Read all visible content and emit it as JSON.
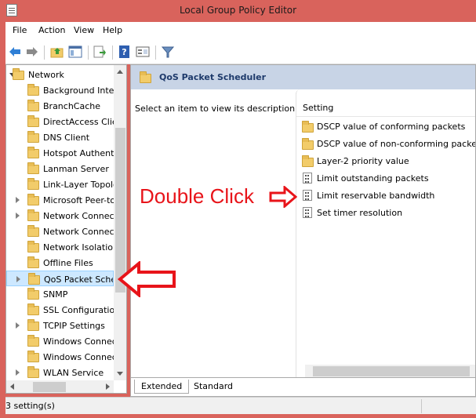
{
  "window": {
    "title": "Local Group Policy Editor"
  },
  "menu": {
    "items": [
      "File",
      "Action",
      "View",
      "Help"
    ]
  },
  "tree": {
    "root_label": "Network",
    "items": [
      "Background Intellig",
      "BranchCache",
      "DirectAccess Client",
      "DNS Client",
      "Hotspot Authentica",
      "Lanman Server",
      "Link-Layer Topolog",
      "Microsoft Peer-to-P",
      "Network Connectio",
      "Network Connectiv",
      "Network Isolation",
      "Offline Files",
      "QoS Packet Schedu",
      "SNMP",
      "SSL Configuration S",
      "TCPIP Settings",
      "Windows Connect I",
      "Windows Connectio",
      "WLAN Service"
    ],
    "selected": "QoS Packet Schedu"
  },
  "details": {
    "header_title": "QoS Packet Scheduler",
    "description": "Select an item to view its description.",
    "column_header": "Setting",
    "settings": [
      {
        "label": "DSCP value of conforming packets",
        "type": "folder"
      },
      {
        "label": "DSCP value of non-conforming packets",
        "type": "folder"
      },
      {
        "label": "Layer-2 priority value",
        "type": "folder"
      },
      {
        "label": "Limit outstanding packets",
        "type": "setting"
      },
      {
        "label": "Limit reservable bandwidth",
        "type": "setting"
      },
      {
        "label": "Set timer resolution",
        "type": "setting"
      }
    ]
  },
  "tabs": {
    "extended": "Extended",
    "standard": "Standard"
  },
  "status": {
    "text": "3 setting(s)"
  },
  "annotation": {
    "text": "Double Click",
    "color": "#e8141a"
  },
  "colors": {
    "titlebar": "#d9635c",
    "header_band": "#c8d4e6",
    "selection": "#cde8ff"
  }
}
